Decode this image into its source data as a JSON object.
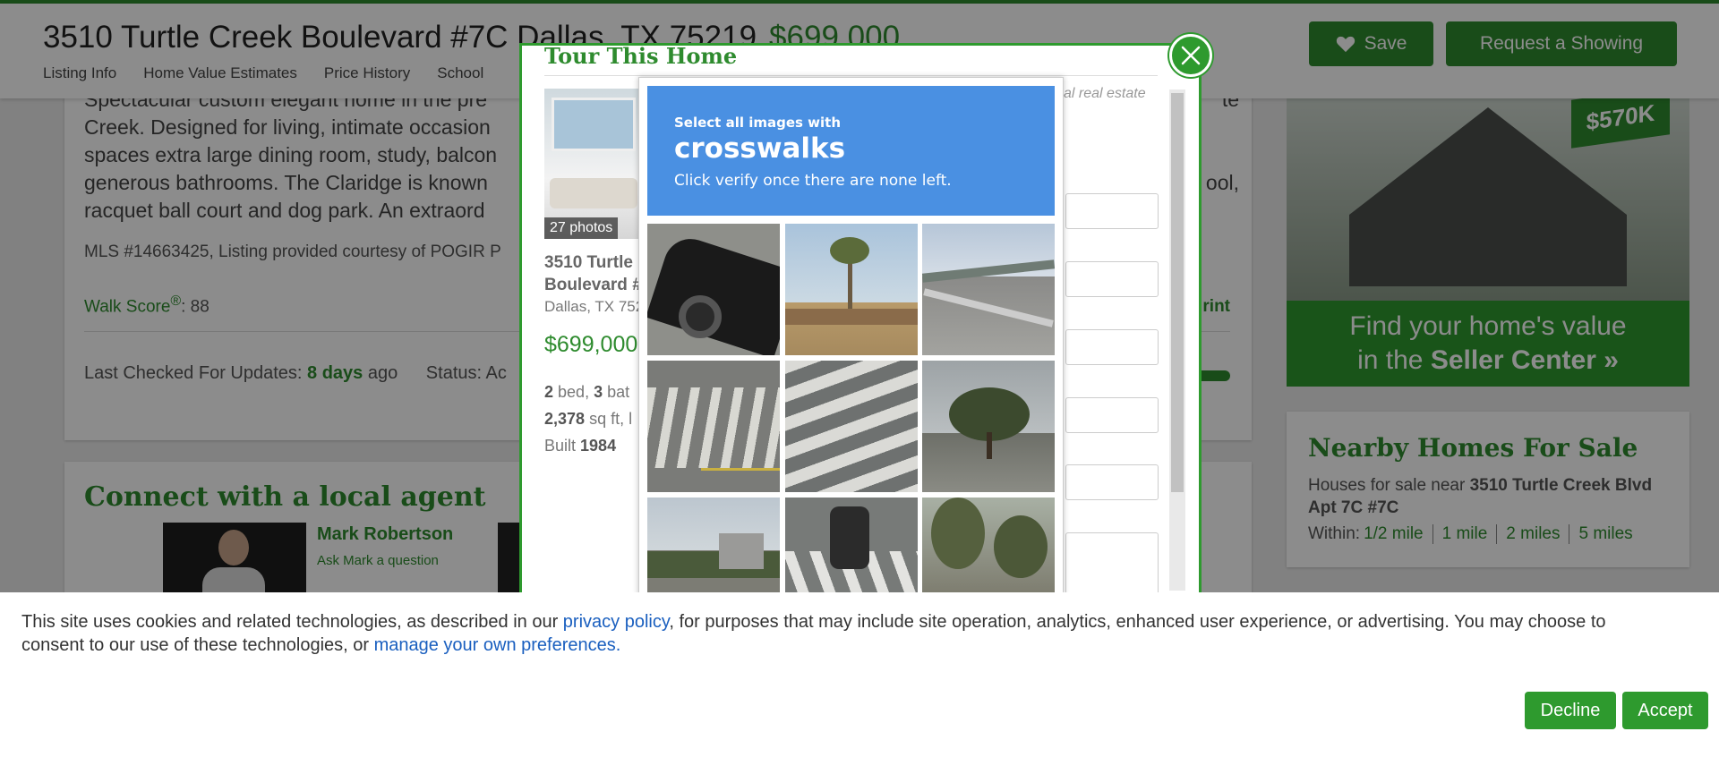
{
  "header": {
    "address": "3510 Turtle Creek Boulevard #7C Dallas, TX 75219",
    "price": "$699,000",
    "nav": [
      "Listing Info",
      "Home Value Estimates",
      "Price History",
      "School"
    ],
    "save_label": "Save",
    "request_label": "Request a Showing"
  },
  "listing": {
    "description_lines": [
      "Spectacular custom elegant home in the pre",
      "Creek. Designed for living, intimate occasion",
      "spaces extra large dining room, study, balcon",
      "generous bathrooms. The Claridge is known",
      "racquet ball court and dog park. An extraord"
    ],
    "description_tail": [
      "te",
      "",
      "",
      "ool,",
      ""
    ],
    "mls": "MLS #14663425, Listing provided courtesy of POGIR P",
    "walk_score_label": "Walk Score",
    "walk_score_reg": "®",
    "walk_score_value": ": 88",
    "print_label": "rint",
    "last_checked_label": "Last Checked For Updates:",
    "last_checked_value": "8 days",
    "last_checked_suffix": "ago",
    "status_label": "Status: Ac"
  },
  "agent": {
    "section_title": "Connect with a local agent",
    "name": "Mark Robertson",
    "ask": "Ask Mark a question"
  },
  "ad": {
    "tag": "$570K",
    "line1": "Find your home's value",
    "line2_prefix": "in the ",
    "line2_bold": "Seller Center »"
  },
  "nearby": {
    "title": "Nearby Homes For Sale",
    "text_prefix": "Houses for sale near ",
    "text_bold": "3510 Turtle Creek Blvd Apt 7C #7C",
    "within_label": "Within:",
    "distances": [
      "1/2 mile",
      "1 mile",
      "2 miles",
      "5 miles"
    ]
  },
  "modal": {
    "title": "Tour This Home",
    "photo_count": "27 photos",
    "address_line1": "3510 Turtle",
    "address_line2": "Boulevard #",
    "city": "Dallas, TX 752",
    "price": "$699,000",
    "beds": "2",
    "beds_label": "bed,",
    "baths": "3",
    "baths_label": "bat",
    "sqft": "2,378",
    "sqft_label": "sq ft, l",
    "built_label": "Built",
    "built_year": "1984",
    "hint_text": "cal real estate"
  },
  "captcha": {
    "instruction": "Select all images with",
    "target": "crosswalks",
    "subtext": "Click verify once there are none left.",
    "tiles": [
      "car-door",
      "palm-tree",
      "highway-overpass",
      "crosswalk-intersection",
      "crosswalk-closeup",
      "trees-cloudy",
      "parking-lot",
      "motorcycle-crosswalk",
      "trees-street"
    ]
  },
  "cookie": {
    "text_part1": "This site uses cookies and related technologies, as described in our ",
    "privacy_link": "privacy policy",
    "text_part2": ", for purposes that may include site operation, analytics, enhanced user experience, or advertising. You may choose to",
    "text_part3": "consent to our use of these technologies, or ",
    "manage_link": "manage your own preferences.",
    "decline_label": "Decline",
    "accept_label": "Accept"
  }
}
